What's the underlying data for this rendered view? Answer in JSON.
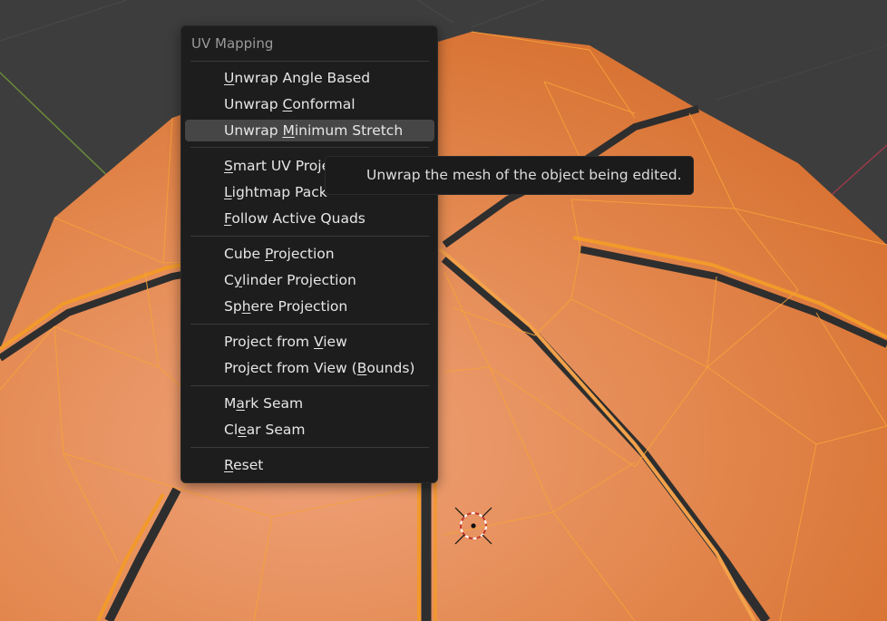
{
  "menu": {
    "title": "UV Mapping",
    "items": [
      {
        "label": "Unwrap Angle Based",
        "mnemonic": "U"
      },
      {
        "label": "Unwrap Conformal",
        "mnemonic": "C"
      },
      {
        "label": "Unwrap Minimum Stretch",
        "mnemonic": "M"
      },
      {
        "label": "Smart UV Project",
        "mnemonic": "S"
      },
      {
        "label": "Lightmap Pack",
        "mnemonic": "L"
      },
      {
        "label": "Follow Active Quads",
        "mnemonic": "F"
      },
      {
        "label": "Cube Projection",
        "mnemonic": "P"
      },
      {
        "label": "Cylinder Projection",
        "mnemonic": "y"
      },
      {
        "label": "Sphere Projection",
        "mnemonic": "h"
      },
      {
        "label": "Project from View",
        "mnemonic": "V"
      },
      {
        "label": "Project from View (Bounds)",
        "mnemonic": "B"
      },
      {
        "label": "Mark Seam",
        "mnemonic": "a"
      },
      {
        "label": "Clear Seam",
        "mnemonic": "e"
      },
      {
        "label": "Reset",
        "mnemonic": "R"
      }
    ],
    "highlighted_label": "Unwrap Minimum Stretch"
  },
  "tooltip": {
    "text": "Unwrap the mesh of the object being edited."
  },
  "colors": {
    "viewport_bg": "#3d3d3d",
    "mesh_orange": "#e88a48",
    "mesh_edge": "#f59a1e",
    "seam_dark": "#2d2d2d",
    "menu_bg": "#1d1d1d",
    "highlight_bg": "#464646"
  },
  "icons": {
    "cursor": "3d-cursor-icon"
  }
}
